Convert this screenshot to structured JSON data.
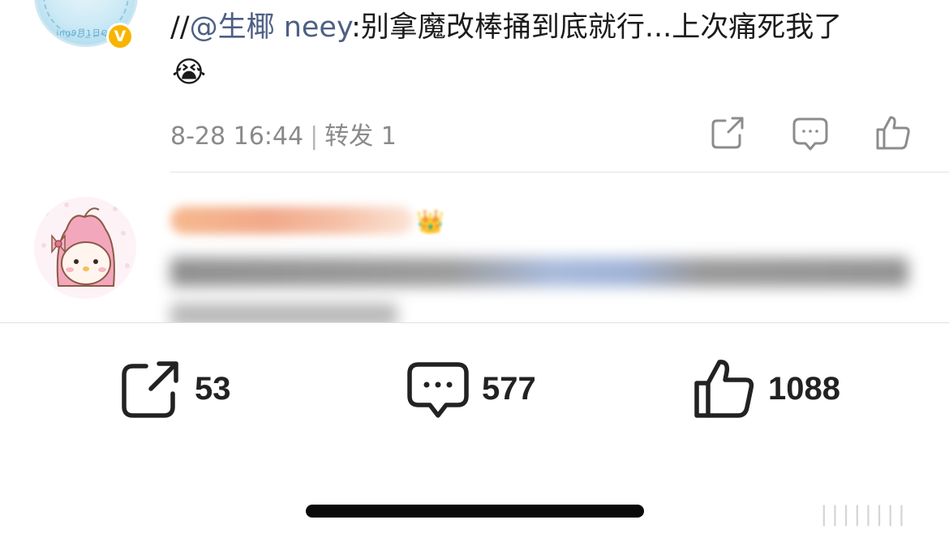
{
  "comment": {
    "prefix": "//",
    "mention": "@生椰 neey",
    "body": ":别拿魔改棒捅到底就行...上次痛死我了",
    "emoji": "😭",
    "date": "8-28 16:44",
    "separator": "|",
    "repost_label": "转发 1"
  },
  "avatar_top": {
    "ring_text": "ing9月1日QQ",
    "badge": "V"
  },
  "second_comment": {
    "crown": "👑"
  },
  "bottom_bar": {
    "repost_count": "53",
    "comment_count": "577",
    "like_count": "1088"
  },
  "watermark": "||||||||",
  "colors": {
    "mention": "#4d5f84",
    "meta": "#8a8a8a",
    "badge": "#f7b500"
  }
}
